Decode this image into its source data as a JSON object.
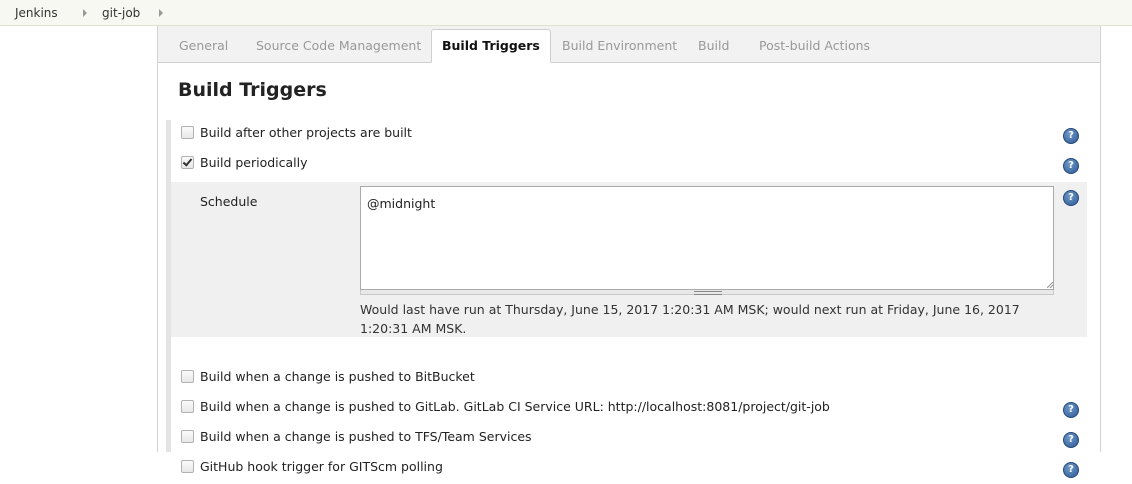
{
  "breadcrumb": {
    "items": [
      "Jenkins",
      "git-job"
    ]
  },
  "tabs": [
    {
      "label": "General"
    },
    {
      "label": "Source Code Management"
    },
    {
      "label": "Build Triggers"
    },
    {
      "label": "Build Environment"
    },
    {
      "label": "Build"
    },
    {
      "label": "Post-build Actions"
    }
  ],
  "active_tab": "Build Triggers",
  "section": {
    "title": "Build Triggers",
    "triggers": [
      {
        "label": "Build after other projects are built",
        "checked": false,
        "help": true
      },
      {
        "label": "Build periodically",
        "checked": true,
        "help": true
      },
      {
        "label": "Build when a change is pushed to BitBucket",
        "checked": false,
        "help": false
      },
      {
        "label": "Build when a change is pushed to GitLab. GitLab CI Service URL: http://localhost:8081/project/git-job",
        "checked": false,
        "help": true
      },
      {
        "label": "Build when a change is pushed to TFS/Team Services",
        "checked": false,
        "help": true
      },
      {
        "label": "GitHub hook trigger for GITScm polling",
        "checked": false,
        "help": true
      }
    ],
    "schedule": {
      "label": "Schedule",
      "value": "@midnight",
      "info": "Would last have run at Thursday, June 15, 2017 1:20:31 AM MSK; would next run at Friday, June 16, 2017 1:20:31 AM MSK."
    }
  },
  "help_glyph": "?",
  "colors": {
    "help_icon": "#2c5b95",
    "active_tab_text": "#111111",
    "inactive_tab_text": "#999999"
  }
}
